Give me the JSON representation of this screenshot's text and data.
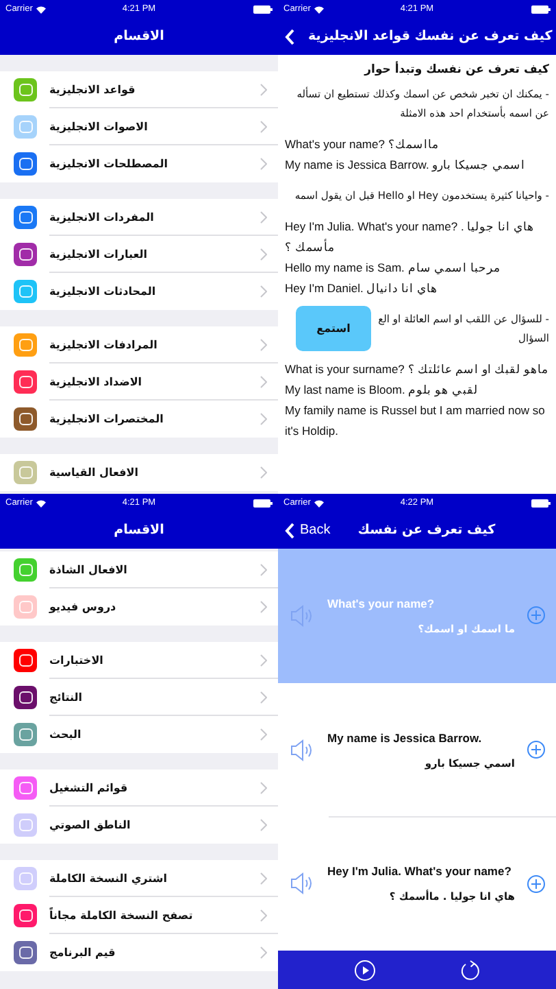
{
  "rows": [
    {
      "screens": [
        {
          "kind": "article",
          "status_bar": {
            "carrier": "Carrier",
            "time": "4:21 PM"
          },
          "nav": {
            "title": "كيف تعرف عن نفسك قواعد الانجليزية",
            "back": true
          },
          "heading": "كيف تعرف عن نفسك وتبدأ حوار",
          "blocks": [
            {
              "kind": "arabic",
              "lines": [
                "- يمكنك ان تخبر شخص عن اسمك وكذلك تستطيع ان تسأله عن اسمه بأستخدام احد هذه الامثلة"
              ]
            },
            {
              "kind": "english",
              "lines": [
                "What's your name? مااسمك؟",
                "My name is Jessica Barrow. اسمي جسيكا بارو"
              ]
            },
            {
              "kind": "arabic",
              "lines": [
                "- واحيانا كثيرة يستخدمون Hey او Hello قبل ان يقول اسمه"
              ]
            },
            {
              "kind": "english",
              "lines": [
                "Hey I'm Julia. What's your name? هاي انا جوليا . مأسمك ؟",
                "Hello my name is Sam. مرحبا اسمي سام",
                "Hey I'm Daniel. هاي انا دانيال"
              ]
            },
            {
              "kind": "arabic",
              "lines": [
                "- للسؤال عن اللقب او اسم العائلة او الع",
                "السؤال"
              ]
            },
            {
              "kind": "english",
              "lines": [
                "What is your surname? ماهو لقبك او اسم عائلتك ؟",
                "My last name is Bloom. لقبي هو بلوم",
                "My family name is Russel but I am married now so it's Holdip."
              ]
            }
          ],
          "listen_button": "استمع"
        },
        {
          "kind": "menu",
          "status_bar": {
            "carrier": "Carrier",
            "time": "4:21 PM"
          },
          "nav": {
            "title": "الاقسام"
          },
          "scrolled": false,
          "sections": [
            {
              "items": [
                {
                  "label": "قواعد الانجليزية",
                  "color": "#6cc41c"
                },
                {
                  "label": "الاصوات الانجليزية",
                  "color": "#a6d3fb"
                },
                {
                  "label": "المصطلحات الانجليزية",
                  "color": "#1a6ff2"
                }
              ]
            },
            {
              "items": [
                {
                  "label": "المفردات الانجليزية",
                  "color": "#1a78f5"
                },
                {
                  "label": "العبارات الانجليزية",
                  "color": "#a12ca8"
                },
                {
                  "label": "المحادثات الانجليزية",
                  "color": "#1ec3f7"
                }
              ]
            },
            {
              "items": [
                {
                  "label": "المرادفات الانجليزية",
                  "color": "#ff9f12"
                },
                {
                  "label": "الاضداد الانجليزية",
                  "color": "#ff2d55"
                },
                {
                  "label": "المختصرات الانجليزية",
                  "color": "#8e5a2b"
                }
              ]
            },
            {
              "items": [
                {
                  "label": "الافعال القياسية",
                  "color": "#c8c89a"
                }
              ]
            }
          ]
        }
      ]
    },
    {
      "screens": [
        {
          "kind": "phrases",
          "status_bar": {
            "carrier": "Carrier",
            "time": "4:22 PM"
          },
          "nav": {
            "title": "كيف تعرف عن نفسك",
            "back": true,
            "back_label": "Back"
          },
          "items": [
            {
              "english": "What's your name?",
              "arabic": "ما اسمك او اسمك؟",
              "selected": true
            },
            {
              "english": "My name is Jessica Barrow.",
              "arabic": "اسمي جسيكا بارو",
              "selected": false
            },
            {
              "english": "Hey I'm Julia. What's your name?",
              "arabic": "هاي انا جوليا . ماأسمك ؟",
              "selected": false
            }
          ]
        },
        {
          "kind": "menu",
          "status_bar": {
            "carrier": "Carrier",
            "time": "4:21 PM"
          },
          "nav": {
            "title": "الاقسام"
          },
          "scrolled": true,
          "sections": [
            {
              "items": [
                {
                  "label": "الافعال الشاذة",
                  "color": "#44d12f"
                },
                {
                  "label": "دروس فيديو",
                  "color": "#ffc8c8"
                }
              ]
            },
            {
              "items": [
                {
                  "label": "الاختبارات",
                  "color": "#ff0000"
                },
                {
                  "label": "النتائج",
                  "color": "#6b0f6b"
                },
                {
                  "label": "البحث",
                  "color": "#6aa3a0"
                }
              ]
            },
            {
              "items": [
                {
                  "label": "قوائم التشغيل",
                  "color": "#f55cf5"
                },
                {
                  "label": "الناطق الصوتي",
                  "color": "#cfcdfb"
                }
              ]
            },
            {
              "items": [
                {
                  "label": "اشتري النسخة الكاملة",
                  "color": "#d0cefc"
                },
                {
                  "label": "تصفح النسخة الكاملة مجاناً",
                  "color": "#ff1a6b"
                },
                {
                  "label": "قيم البرنامج",
                  "color": "#6a6aa8"
                }
              ]
            }
          ]
        }
      ]
    }
  ]
}
